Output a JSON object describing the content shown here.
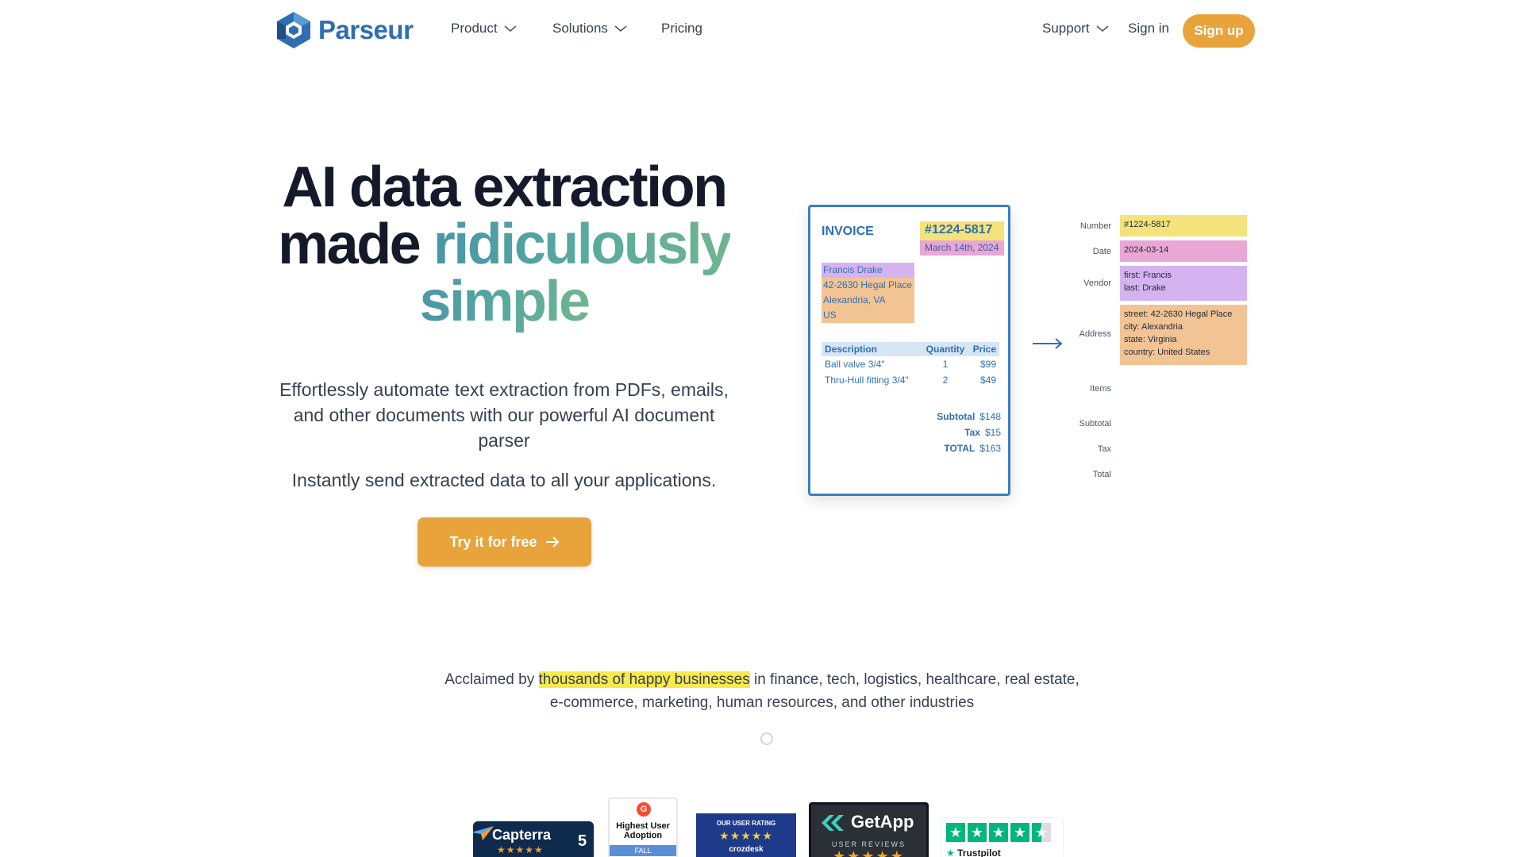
{
  "nav": {
    "logo_text": "Parseur",
    "product": "Product",
    "solutions": "Solutions",
    "pricing": "Pricing",
    "support": "Support",
    "signin": "Sign in",
    "signup": "Sign up"
  },
  "hero": {
    "title_line1": "AI data extraction",
    "title_made": "made",
    "title_ridiculously": "ridiculously",
    "title_simple": "simple",
    "subtitle": "Effortlessly automate text extraction from PDFs, emails, and other documents with our powerful AI document parser",
    "subtitle2": "Instantly send extracted data to all your applications.",
    "cta": "Try it for free"
  },
  "invoice": {
    "title": "INVOICE",
    "number": "#1224-5817",
    "date": "March 14th, 2024",
    "address": [
      "Francis Drake",
      "42-2630 Hegal Place",
      "Alexandria, VA",
      "US"
    ],
    "headers": [
      "Description",
      "Quantity",
      "Price"
    ],
    "rows": [
      [
        "Ball valve 3/4\"",
        "1",
        "$99"
      ],
      [
        "Thru-Hull fitting 3/4\"",
        "2",
        "$49"
      ]
    ],
    "subtotal_label": "Subtotal",
    "subtotal": "$148",
    "tax_label": "Tax",
    "tax": "$15",
    "total_label": "TOTAL",
    "total": "$163"
  },
  "extracted": {
    "number_label": "Number",
    "number": "#1224-5817",
    "date_label": "Date",
    "date": "2024-03-14",
    "vendor_label": "Vendor",
    "vendor_first": "first: Francis",
    "vendor_last": "last: Drake",
    "address_label": "Address",
    "address_street": "street: 42-2630 Hegal Place",
    "address_city": "city: Alexandria",
    "address_state": "state: Virginia",
    "address_country": "country: United States",
    "items_label": "Items",
    "subtotal_label": "Subtotal",
    "tax_label": "Tax",
    "total_label": "Total"
  },
  "acclaim": {
    "prefix": "Acclaimed by ",
    "highlight": "thousands of happy businesses",
    "suffix": " in finance, tech, logistics, healthcare, real estate, e-commerce, marketing, human resources, and other industries"
  },
  "badges": {
    "capterra": "Capterra",
    "capterra_score": "5",
    "g2_line1": "Highest User",
    "g2_line2": "Adoption",
    "g2_season": "FALL",
    "crozdesk_top": "OUR USER RATING",
    "crozdesk_brand": "crozdesk",
    "getapp": "GetApp",
    "getapp_sub": "USER REVIEWS",
    "trustpilot": "Trustpilot"
  },
  "colors": {
    "brand_blue": "#2f6fb0",
    "accent_orange": "#e8a33a",
    "highlight_yellow": "#f7ea4a"
  }
}
